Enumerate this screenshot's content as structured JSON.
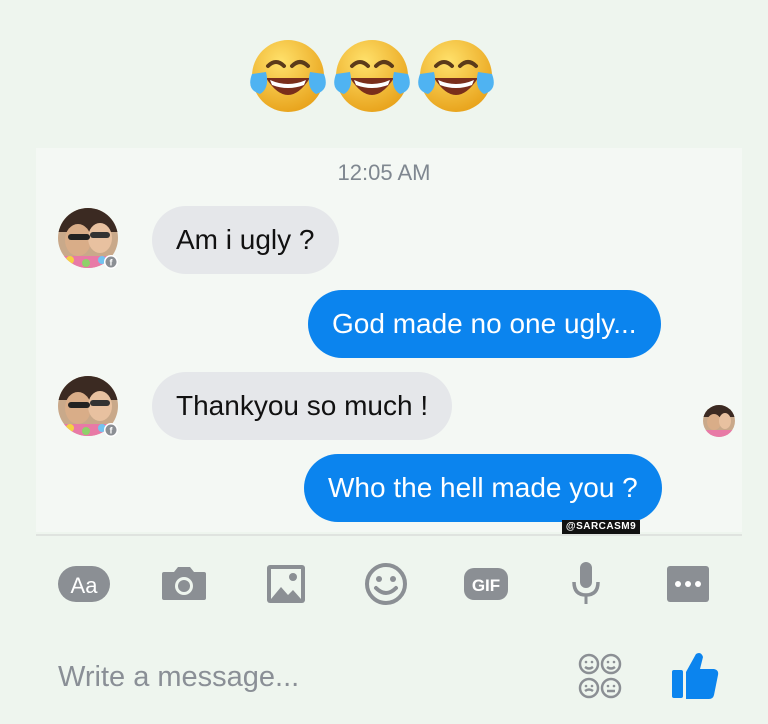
{
  "header": {
    "emojis": [
      "face-with-tears-of-joy-icon",
      "face-with-tears-of-joy-icon",
      "face-with-tears-of-joy-icon"
    ]
  },
  "conversation": {
    "timestamp": "12:05 AM",
    "messages": [
      {
        "direction": "incoming",
        "text": "Am i ugly ?"
      },
      {
        "direction": "outgoing",
        "text": "God made no one ugly..."
      },
      {
        "direction": "incoming",
        "text": "Thankyou so much !"
      },
      {
        "direction": "outgoing",
        "text": "Who the hell made you ?"
      }
    ]
  },
  "watermark": "@SARCASM9",
  "toolbar": {
    "text_label": "Aa",
    "gif_label": "GIF",
    "icons": [
      "text-icon",
      "camera-icon",
      "image-icon",
      "emoji-icon",
      "gif-icon",
      "microphone-icon",
      "more-icon"
    ]
  },
  "composer": {
    "placeholder": "Write a message...",
    "icons": [
      "stickers-icon",
      "like-icon"
    ]
  },
  "colors": {
    "background": "#eef5ee",
    "incoming_bubble": "#e5e7ea",
    "outgoing_bubble": "#0b84ee",
    "icon_gray": "#8b8f94",
    "emoji_yellow": "#f6c337"
  }
}
